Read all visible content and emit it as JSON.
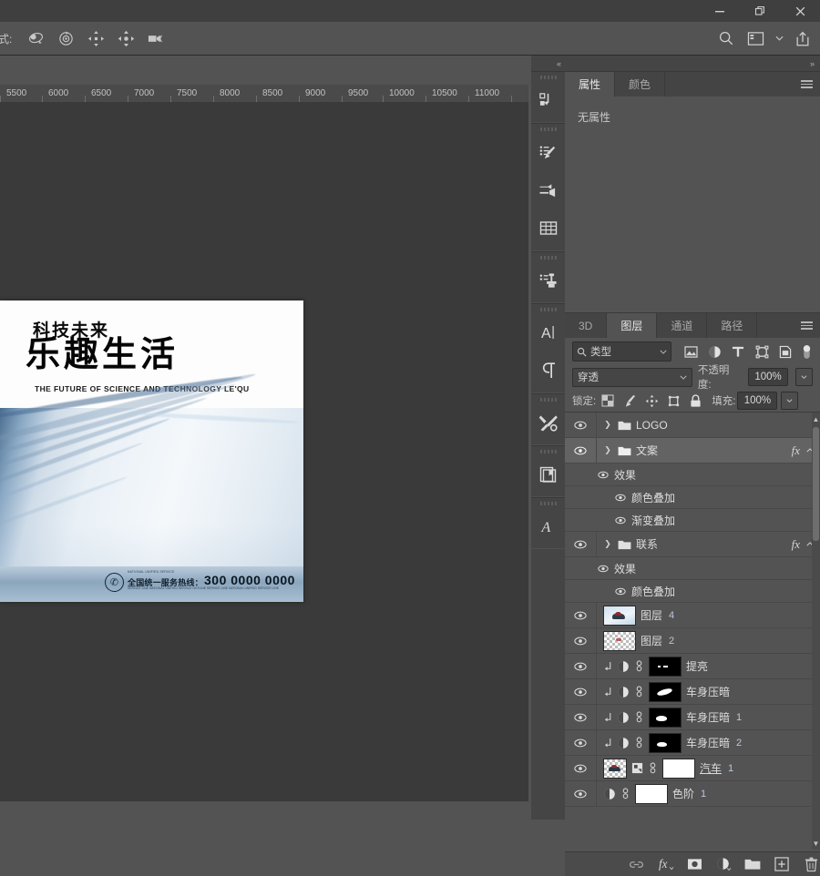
{
  "window": {
    "minimize_label": "Minimize",
    "restore_label": "Restore",
    "close_label": "Close"
  },
  "options_bar": {
    "mode_label": "式:",
    "tools": [
      "3d-rotate-icon",
      "3d-roll-icon",
      "3d-pan-icon",
      "3d-slide-icon",
      "3d-camera-icon"
    ],
    "right_tools": [
      "search-icon",
      "workspace-icon",
      "chevron-down-icon",
      "share-icon"
    ]
  },
  "ruler": {
    "ticks": [
      "5500",
      "6000",
      "6500",
      "7000",
      "7500",
      "8000",
      "8500",
      "9000",
      "9500",
      "10000",
      "10500",
      "11000"
    ],
    "unit_step": 500
  },
  "document": {
    "poster": {
      "subtitle": "科技未来",
      "title": "乐趣生活",
      "english": "THE FUTURE OF SCIENCE AND TECHNOLOGY LE'QU",
      "footer_small_top": "NATIONAL UNIFIED SERVICE",
      "footer_label": "全国统一服务热线：",
      "footer_number": "300 0000 0000",
      "footer_small_bottom": "SERVICE LINE NATIONAL UNIFIED SERVICE HOTLINE SERVICE LINE NATIONAL UNIFIED SERVICE LINE"
    }
  },
  "icon_dock": {
    "collapse_label": "«",
    "groups": [
      {
        "items": [
          "history-panel-icon"
        ]
      },
      {
        "items": [
          "brushes-panel-icon",
          "brush-settings-panel-icon",
          "patterns-panel-icon"
        ]
      },
      {
        "items": [
          "clone-source-panel-icon"
        ]
      },
      {
        "items": [
          "character-panel-icon",
          "paragraph-panel-icon"
        ]
      },
      {
        "items": [
          "tool-presets-panel-icon"
        ]
      },
      {
        "items": [
          "libraries-panel-icon"
        ]
      },
      {
        "items": [
          "glyphs-panel-icon"
        ]
      }
    ]
  },
  "properties_panel": {
    "expand_label": "»",
    "tabs": [
      {
        "label": "属性",
        "active": true
      },
      {
        "label": "颜色",
        "active": false
      }
    ],
    "body_text": "无属性",
    "menu_icon": "panel-menu-icon"
  },
  "layers_panel": {
    "tabs": [
      {
        "label": "3D",
        "active": false
      },
      {
        "label": "图层",
        "active": true
      },
      {
        "label": "通道",
        "active": false
      },
      {
        "label": "路径",
        "active": false
      }
    ],
    "menu_icon": "panel-menu-icon",
    "filter": {
      "search_icon": "search-icon",
      "kind_label": "类型",
      "chevron": "chevron-down-icon",
      "type_filters": [
        "pixel-filter-icon",
        "adjustment-filter-icon",
        "text-filter-icon",
        "shape-filter-icon",
        "smartobject-filter-icon"
      ],
      "toggle_icon": "filter-toggle-switch"
    },
    "blend": {
      "mode": "穿透",
      "opacity_label": "不透明度:",
      "opacity_value": "100%"
    },
    "lock": {
      "label": "锁定:",
      "icons": [
        "lock-transparent-icon",
        "lock-image-icon",
        "lock-position-icon",
        "lock-nesting-icon",
        "lock-all-icon"
      ],
      "fill_label": "填充:",
      "fill_value": "100%"
    },
    "layers": [
      {
        "type": "group",
        "name": "LOGO",
        "visible": true,
        "selected": false,
        "expanded": false,
        "has_fx": false
      },
      {
        "type": "group",
        "name": "文案",
        "visible": true,
        "selected": true,
        "expanded": false,
        "has_fx": true,
        "effects": {
          "label": "效果",
          "items": [
            "颜色叠加",
            "渐变叠加"
          ]
        }
      },
      {
        "type": "group",
        "name": "联系",
        "visible": true,
        "selected": false,
        "expanded": false,
        "has_fx": true,
        "effects": {
          "label": "效果",
          "items": [
            "颜色叠加"
          ]
        }
      },
      {
        "type": "pixel",
        "name": "图层",
        "suffix": "4",
        "visible": true,
        "thumb": "photo"
      },
      {
        "type": "pixel",
        "name": "图层",
        "suffix": "2",
        "visible": true,
        "thumb": "checker"
      },
      {
        "type": "adjustment",
        "name": "提亮",
        "visible": true,
        "clipped": true,
        "mask": "dots"
      },
      {
        "type": "adjustment",
        "name": "车身压暗",
        "visible": true,
        "clipped": true,
        "mask": "streak"
      },
      {
        "type": "adjustment",
        "name": "车身压暗",
        "suffix": "1",
        "visible": true,
        "clipped": true,
        "mask": "blob"
      },
      {
        "type": "adjustment",
        "name": "车身压暗",
        "suffix": "2",
        "visible": true,
        "clipped": true,
        "mask": "blob"
      },
      {
        "type": "smartobject",
        "name": "汽车",
        "suffix": "1",
        "visible": true,
        "underline": true,
        "mask": "white"
      },
      {
        "type": "adjustment",
        "name": "色阶",
        "suffix": "1",
        "visible": true,
        "mask": "white"
      }
    ],
    "bottom_buttons": [
      "link-layers-icon",
      "add-layer-style-icon",
      "add-layer-mask-icon",
      "new-adjustment-icon",
      "new-group-icon",
      "new-layer-icon",
      "delete-layer-icon"
    ]
  }
}
